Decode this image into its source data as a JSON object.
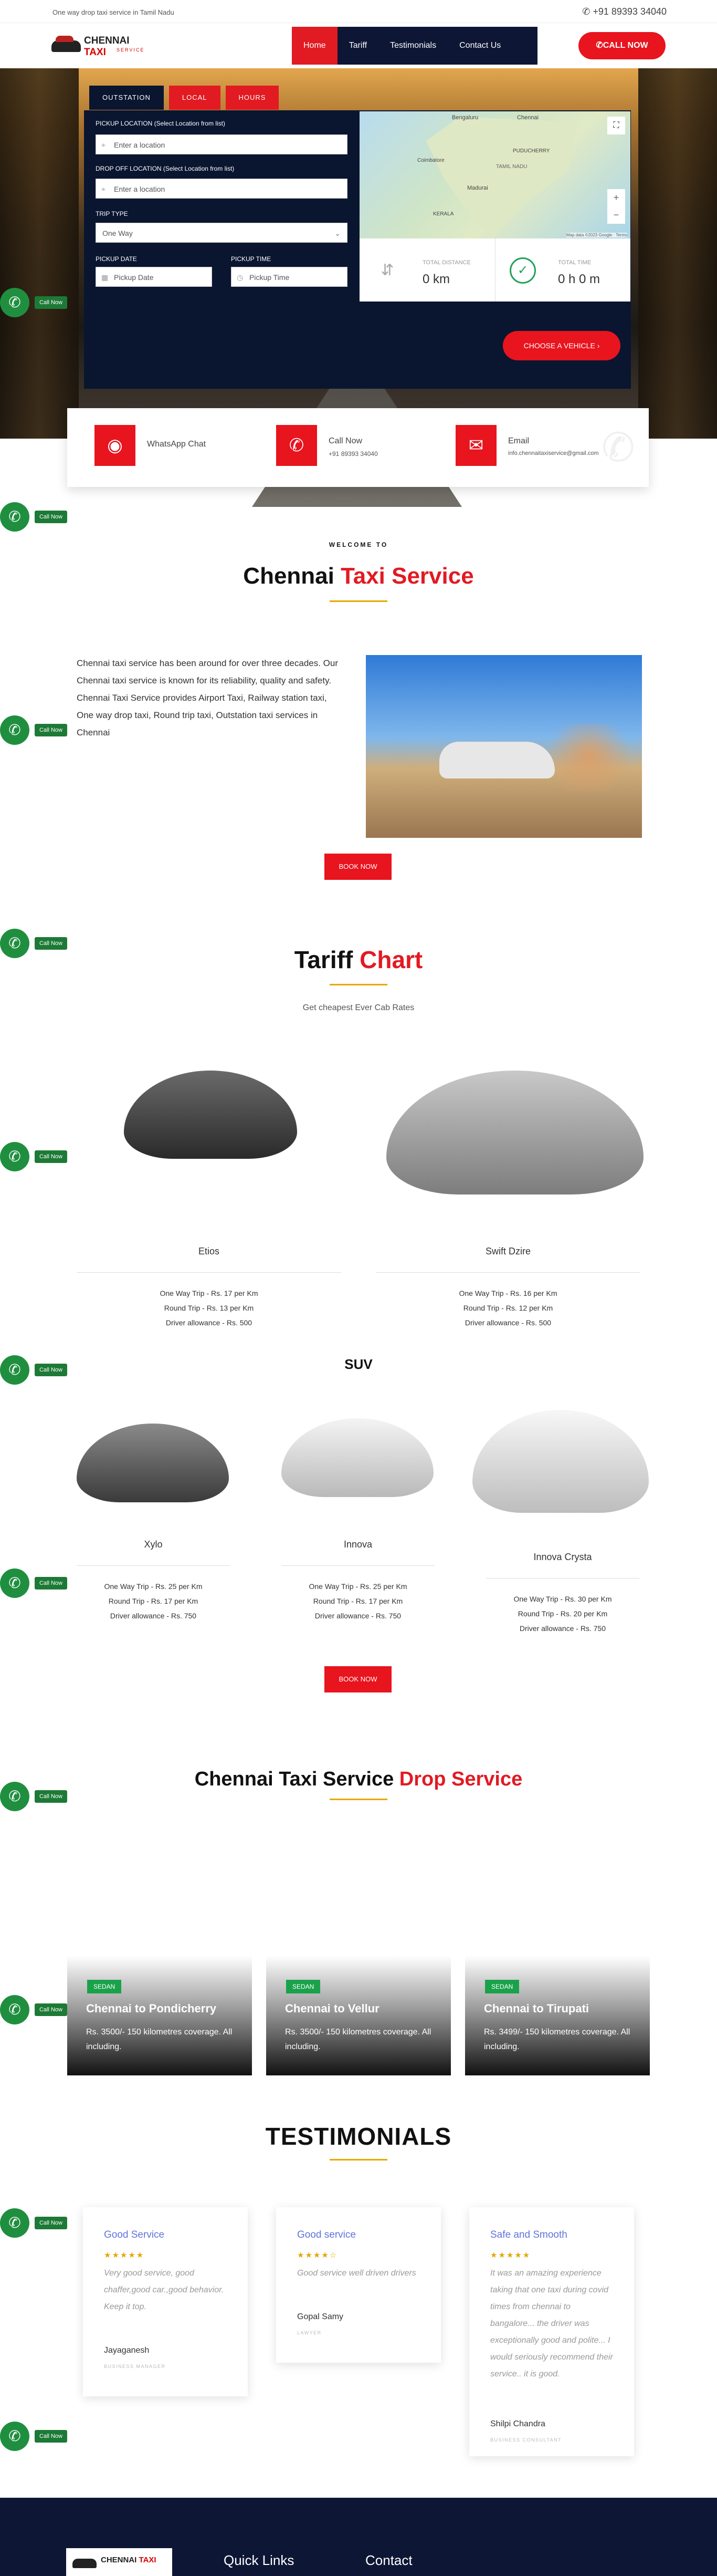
{
  "topbar": {
    "tagline": "One way drop taxi service in Tamil Nadu",
    "phone": "+91 89393 34040"
  },
  "brand": {
    "name1": "CHENNAI",
    "name2": "TAXI",
    "sub": "SERVICE"
  },
  "nav": [
    "Home",
    "Tariff",
    "Testimonials",
    "Contact Us"
  ],
  "call_now": "CALL NOW",
  "booking": {
    "tabs": [
      "OUTSTATION",
      "LOCAL",
      "HOURS"
    ],
    "pickup_label": "PICKUP LOCATION (Select Location from list)",
    "pickup_placeholder": "Enter a location",
    "drop_label": "DROP OFF LOCATION (Select Location from list)",
    "drop_placeholder": "Enter a location",
    "trip_label": "TRIP TYPE",
    "trip_value": "One Way",
    "date_label": "PICKUP DATE",
    "date_placeholder": "Pickup Date",
    "time_label": "PICKUP TIME",
    "time_placeholder": "Pickup Time",
    "map_labels": [
      "Bengaluru",
      "Chennai",
      "Puducherry",
      "Madurai",
      "Kerala",
      "Tamil Nadu",
      "Coimbatore"
    ],
    "map_footer": "Map data ©2023 Google · Terms",
    "distance_label": "TOTAL DISTANCE",
    "distance_value": "0 km",
    "time_total_label": "TOTAL TIME",
    "time_total_value": "0 h 0 m",
    "choose": "CHOOSE A VEHICLE"
  },
  "contact": [
    {
      "title": "WhatsApp Chat",
      "sub": ""
    },
    {
      "title": "Call Now",
      "sub": "+91 89393 34040"
    },
    {
      "title": "Email",
      "sub": "info.chennaitaxiservice@gmail.com"
    }
  ],
  "float_call": "Call Now",
  "welcome": {
    "kicker": "WELCOME TO",
    "title_a": "Chennai ",
    "title_b": "Taxi Service",
    "body": "Chennai taxi service has been around for over three decades. Our Chennai taxi service is known for its reliability, quality and safety. Chennai Taxi Service provides Airport Taxi, Railway station taxi, One way drop taxi, Round trip taxi, Outstation taxi services in Chennai",
    "book": "BOOK NOW"
  },
  "tariff": {
    "title_a": "Tariff ",
    "title_b": "Chart",
    "sub": "Get cheapest Ever Cab Rates",
    "suv": "SUV",
    "book": "BOOK NOW",
    "sedans": [
      {
        "name": "Etios",
        "lines": [
          "One Way Trip - Rs. 17 per Km",
          "Round Trip - Rs. 13 per Km",
          "Driver allowance - Rs. 500"
        ]
      },
      {
        "name": "Swift Dzire",
        "lines": [
          "One Way Trip - Rs. 16 per Km",
          "Round Trip - Rs. 12 per Km",
          "Driver allowance - Rs. 500"
        ]
      }
    ],
    "suvs": [
      {
        "name": "Xylo",
        "lines": [
          "One Way Trip - Rs. 25 per Km",
          "Round Trip - Rs. 17 per Km",
          "Driver allowance - Rs. 750"
        ]
      },
      {
        "name": "Innova",
        "lines": [
          "One Way Trip - Rs. 25 per Km",
          "Round Trip - Rs. 17 per Km",
          "Driver allowance - Rs. 750"
        ]
      },
      {
        "name": "Innova Crysta",
        "lines": [
          "One Way Trip - Rs. 30 per Km",
          "Round Trip - Rs. 20 per Km",
          "Driver allowance - Rs. 750"
        ]
      }
    ]
  },
  "drop": {
    "title_a": "Chennai Taxi Service ",
    "title_b": "Drop Service",
    "cards": [
      {
        "badge": "SEDAN",
        "title": "Chennai to Pondicherry",
        "desc": "Rs. 3500/- 150 kilometres coverage. All including."
      },
      {
        "badge": "SEDAN",
        "title": "Chennai to Vellur",
        "desc": "Rs. 3500/- 150 kilometres coverage. All including."
      },
      {
        "badge": "SEDAN",
        "title": "Chennai to Tirupati",
        "desc": "Rs. 3499/- 150 kilometres coverage. All including."
      }
    ]
  },
  "testimonials": {
    "title": "TESTIMONIALS",
    "items": [
      {
        "head": "Good Service",
        "stars": "★★★★★",
        "quote": "Very good service, good chaffer,good car.,good behavior. Keep it top.",
        "name": "Jayaganesh",
        "role": "BUSINESS MANAGER"
      },
      {
        "head": "Good service",
        "stars": "★★★★☆",
        "quote": "Good service well driven drivers",
        "name": "Gopal Samy",
        "role": "LAWYER"
      },
      {
        "head": "Safe and Smooth",
        "stars": "★★★★★",
        "quote": "It was an amazing experience taking that one taxi during covid times from chennai to bangalore... the driver was exceptionally good and polite... I would seriously recommend their service.. it is good.",
        "name": "Shilpi Chandra",
        "role": "BUSINESS CONSULTANT"
      }
    ]
  },
  "footer": {
    "quick": "Quick Links",
    "contact": "Contact"
  },
  "colors": {
    "red": "#e8141e",
    "navy": "#0d1634",
    "green": "#1f8f3f",
    "gold": "#e8a800"
  }
}
